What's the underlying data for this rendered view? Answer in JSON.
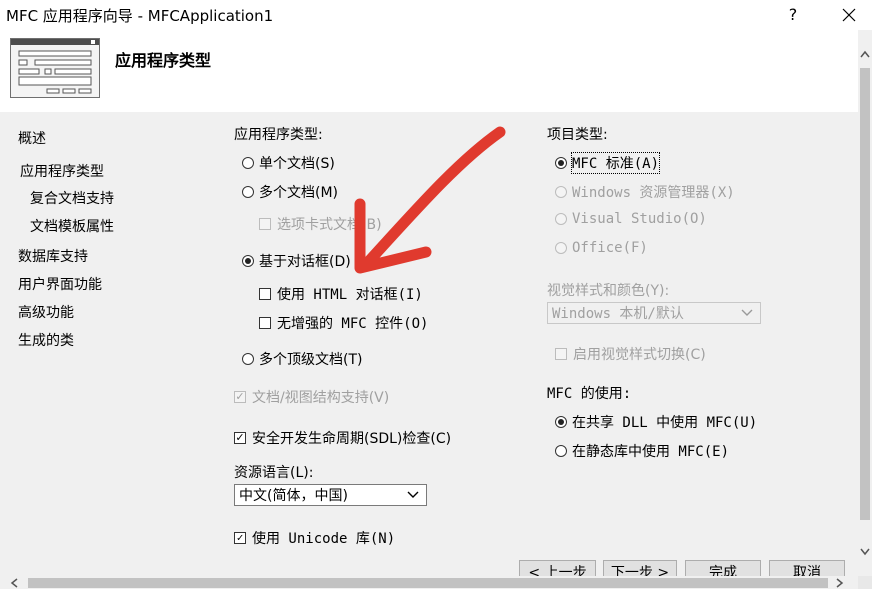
{
  "window": {
    "title": "MFC 应用程序向导 - MFCApplication1",
    "help_glyph": "?",
    "close_glyph": "╳"
  },
  "header": {
    "title": "应用程序类型"
  },
  "sidebar": {
    "items": [
      {
        "label": "概述"
      },
      {
        "label": "应用程序类型"
      },
      {
        "label": "复合文档支持"
      },
      {
        "label": "文档模板属性"
      },
      {
        "label": "数据库支持"
      },
      {
        "label": "用户界面功能"
      },
      {
        "label": "高级功能"
      },
      {
        "label": "生成的类"
      }
    ]
  },
  "app_type": {
    "group_label": "应用程序类型:",
    "single_doc": "单个文档(S)",
    "multi_doc": "多个文档(M)",
    "tabbed_docs": "选项卡式文档(B)",
    "dialog_based": "基于对话框(D)",
    "use_html_dialog": "使用 HTML 对话框(I)",
    "no_enhanced_mfc": "无增强的 MFC 控件(O)",
    "multi_top_level": "多个顶级文档(T)",
    "doc_view": "文档/视图结构支持(V)",
    "sdl_check": "安全开发生命周期(SDL)检查(C)",
    "resource_lang_label": "资源语言(L):",
    "resource_lang_value": "中文(简体，中国)",
    "unicode_lib": "使用 Unicode 库(N)"
  },
  "project_type": {
    "group_label": "项目类型:",
    "mfc_standard": "MFC 标准(A)",
    "windows_explorer": "Windows 资源管理器(X)",
    "visual_studio": "Visual Studio(O)",
    "office": "Office(F)",
    "visual_style_label": "视觉样式和颜色(Y):",
    "visual_style_value": "Windows 本机/默认",
    "enable_style_switch": "启用视觉样式切换(C)"
  },
  "mfc_use": {
    "group_label": "MFC 的使用:",
    "shared_dll": "在共享 DLL 中使用 MFC(U)",
    "static_lib": "在静态库中使用 MFC(E)"
  },
  "buttons": {
    "prev": "< 上一步",
    "next": "下一步 >",
    "finish": "完成",
    "cancel": "取消"
  },
  "icons": {
    "dropdown": "chevron-down-icon",
    "check": "checkmark-icon",
    "scroll_up": "scroll-up-icon",
    "scroll_down": "scroll-down-icon",
    "scroll_left": "scroll-left-icon",
    "scroll_right": "scroll-right-icon",
    "annotation": "red-arrow-annotation"
  },
  "colors": {
    "content_bg": "#f0f0f0",
    "disabled_text": "#a0a0a0",
    "annotation_red": "#e03a2e"
  }
}
